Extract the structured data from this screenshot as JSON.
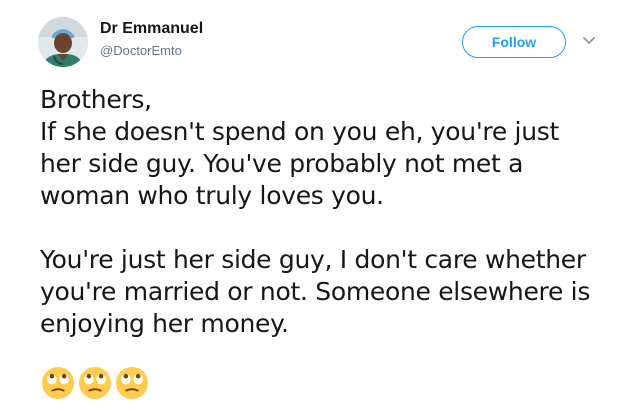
{
  "author": {
    "name": "Dr Emmanuel",
    "handle": "@DoctorEmto",
    "avatar_icon": "doctor-avatar"
  },
  "actions": {
    "follow_label": "Follow",
    "menu_icon": "chevron-down-icon"
  },
  "tweet": {
    "text": "Brothers,\nIf she doesn't spend on you eh, you're just\nher side guy. You've probably not met a\nwoman who truly loves you.\n\nYou're just her side guy, I don't care whether\nyou're married or not. Someone elsewhere is\nenjoying her money.",
    "emojis": [
      "face-with-rolling-eyes",
      "face-with-rolling-eyes",
      "face-with-rolling-eyes"
    ]
  },
  "colors": {
    "accent": "#1da1f2",
    "text": "#14171a",
    "secondary": "#657786"
  }
}
